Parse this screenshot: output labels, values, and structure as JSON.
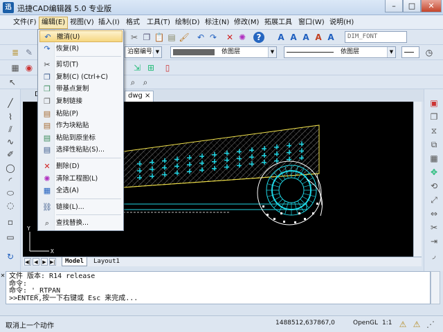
{
  "app": {
    "logo_text": "迅",
    "title": "迅捷CAD编辑器 5.0 专业版",
    "window_controls": {
      "minimize": "–",
      "maximize": "□",
      "close": "✕"
    }
  },
  "menubar": {
    "items": [
      {
        "label": "文件(F)"
      },
      {
        "label": "编辑(E)"
      },
      {
        "label": "视图(V)"
      },
      {
        "label": "插入(I)"
      },
      {
        "label": "格式"
      },
      {
        "label": "工具(T)"
      },
      {
        "label": "绘制(D)"
      },
      {
        "label": "标注(N)"
      },
      {
        "label": "修改(M)"
      },
      {
        "label": "拓展工具"
      },
      {
        "label": "窗口(W)"
      },
      {
        "label": "说明(H)"
      }
    ],
    "active_index": 1
  },
  "toolbar": {
    "text_style_value": "DIM_FONT",
    "linetype_value": "ByLayer",
    "layer_field_left": "泊窑编号二",
    "color_field_value": "依图层",
    "lineweight_value": "依图层"
  },
  "edit_menu": {
    "items": [
      {
        "label": "撤消(U)",
        "icon": "undo-icon",
        "highlighted": true
      },
      {
        "label": "恢复(R)",
        "icon": "redo-icon"
      },
      {
        "sep": true
      },
      {
        "label": "剪切(T)",
        "icon": "cut-icon"
      },
      {
        "label": "复制(C) (Ctrl+C)",
        "icon": "copy-icon"
      },
      {
        "label": "带基点复制",
        "icon": "copy-base-icon"
      },
      {
        "label": "复制链接",
        "icon": "copy-link-icon"
      },
      {
        "label": "粘贴(P)",
        "icon": "paste-icon"
      },
      {
        "label": "作为块粘贴",
        "icon": "paste-block-icon"
      },
      {
        "label": "粘贴到原坐标",
        "icon": "paste-orig-icon"
      },
      {
        "label": "选择性粘贴(S)...",
        "icon": "paste-special-icon"
      },
      {
        "sep": true
      },
      {
        "label": "删除(D)",
        "icon": "delete-icon"
      },
      {
        "label": "清除工程图(L)",
        "icon": "purge-icon"
      },
      {
        "label": "全选(A)",
        "icon": "select-all-icon"
      },
      {
        "sep": true
      },
      {
        "label": "链接(L)...",
        "icon": "link-icon"
      },
      {
        "sep": true
      },
      {
        "label": "查找替换...",
        "icon": "find-icon"
      }
    ]
  },
  "document": {
    "tab_label": "dwg ×",
    "tab_prefix": "D"
  },
  "layout": {
    "nav": [
      "◀|",
      "◀",
      "▶",
      "▶|"
    ],
    "tabs": [
      "Model",
      "Layout1"
    ]
  },
  "command": {
    "lines": [
      "文件 版本: R14 release",
      "命令:",
      "命令: '_RTPAN",
      ">>ENTER,按一下右键或 Esc 来完成..."
    ]
  },
  "status": {
    "text": "取消上一个动作",
    "coords": "1488512,637867,0",
    "render": "OpenGL",
    "scale": "1:1"
  },
  "colors": {
    "canvas_bg": "#000000",
    "drawing_cyan": "#1fd7e6",
    "drawing_yellow": "#f2e24a",
    "drawing_white": "#ffffff",
    "menu_highlight": "#f6d680"
  },
  "axis": {
    "x": "X",
    "y": "Y"
  }
}
